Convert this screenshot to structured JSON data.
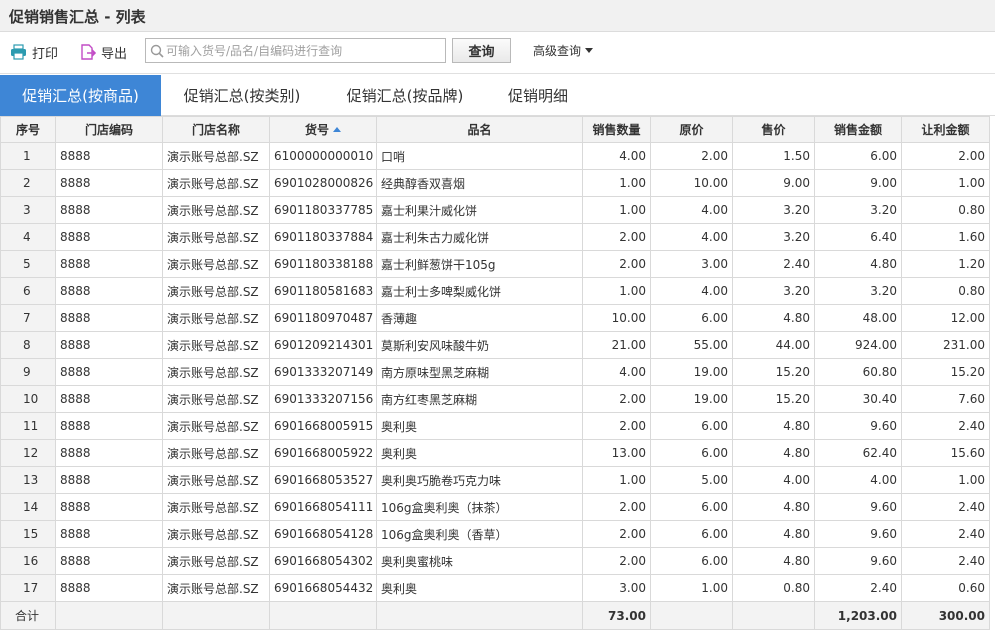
{
  "window": {
    "title": "促销销售汇总 - 列表"
  },
  "toolbar": {
    "print_label": "打印",
    "print_icon": "printer-icon",
    "export_label": "导出",
    "export_icon": "export-icon",
    "search_placeholder": "可输入货号/品名/自编码进行查询",
    "search_value": "",
    "query_label": "查询",
    "advanced_label": "高级查询"
  },
  "tabs": [
    {
      "label": "促销汇总(按商品)",
      "active": true
    },
    {
      "label": "促销汇总(按类别)",
      "active": false
    },
    {
      "label": "促销汇总(按品牌)",
      "active": false
    },
    {
      "label": "促销明细",
      "active": false
    }
  ],
  "table": {
    "columns": [
      "序号",
      "门店编码",
      "门店名称",
      "货号",
      "品名",
      "销售数量",
      "原价",
      "售价",
      "销售金额",
      "让利金额"
    ],
    "sort_column": "货号",
    "sort_direction": "asc",
    "rows": [
      [
        "1",
        "8888",
        "演示账号总部.SZ",
        "6100000000010",
        "口哨",
        "4.00",
        "2.00",
        "1.50",
        "6.00",
        "2.00"
      ],
      [
        "2",
        "8888",
        "演示账号总部.SZ",
        "6901028000826",
        "经典醇香双喜烟",
        "1.00",
        "10.00",
        "9.00",
        "9.00",
        "1.00"
      ],
      [
        "3",
        "8888",
        "演示账号总部.SZ",
        "6901180337785",
        "嘉士利果汁威化饼",
        "1.00",
        "4.00",
        "3.20",
        "3.20",
        "0.80"
      ],
      [
        "4",
        "8888",
        "演示账号总部.SZ",
        "6901180337884",
        "嘉士利朱古力威化饼",
        "2.00",
        "4.00",
        "3.20",
        "6.40",
        "1.60"
      ],
      [
        "5",
        "8888",
        "演示账号总部.SZ",
        "6901180338188",
        "嘉士利鲜葱饼干105g",
        "2.00",
        "3.00",
        "2.40",
        "4.80",
        "1.20"
      ],
      [
        "6",
        "8888",
        "演示账号总部.SZ",
        "6901180581683",
        "嘉士利士多啤梨威化饼",
        "1.00",
        "4.00",
        "3.20",
        "3.20",
        "0.80"
      ],
      [
        "7",
        "8888",
        "演示账号总部.SZ",
        "6901180970487",
        "香薄趣",
        "10.00",
        "6.00",
        "4.80",
        "48.00",
        "12.00"
      ],
      [
        "8",
        "8888",
        "演示账号总部.SZ",
        "6901209214301",
        "莫斯利安风味酸牛奶",
        "21.00",
        "55.00",
        "44.00",
        "924.00",
        "231.00"
      ],
      [
        "9",
        "8888",
        "演示账号总部.SZ",
        "6901333207149",
        "南方原味型黑芝麻糊",
        "4.00",
        "19.00",
        "15.20",
        "60.80",
        "15.20"
      ],
      [
        "10",
        "8888",
        "演示账号总部.SZ",
        "6901333207156",
        "南方红枣黑芝麻糊",
        "2.00",
        "19.00",
        "15.20",
        "30.40",
        "7.60"
      ],
      [
        "11",
        "8888",
        "演示账号总部.SZ",
        "6901668005915",
        "奥利奥",
        "2.00",
        "6.00",
        "4.80",
        "9.60",
        "2.40"
      ],
      [
        "12",
        "8888",
        "演示账号总部.SZ",
        "6901668005922",
        "奥利奥",
        "13.00",
        "6.00",
        "4.80",
        "62.40",
        "15.60"
      ],
      [
        "13",
        "8888",
        "演示账号总部.SZ",
        "6901668053527",
        "奥利奥巧脆卷巧克力味",
        "1.00",
        "5.00",
        "4.00",
        "4.00",
        "1.00"
      ],
      [
        "14",
        "8888",
        "演示账号总部.SZ",
        "6901668054111",
        "106g盒奥利奥（抹茶）",
        "2.00",
        "6.00",
        "4.80",
        "9.60",
        "2.40"
      ],
      [
        "15",
        "8888",
        "演示账号总部.SZ",
        "6901668054128",
        "106g盒奥利奥（香草）",
        "2.00",
        "6.00",
        "4.80",
        "9.60",
        "2.40"
      ],
      [
        "16",
        "8888",
        "演示账号总部.SZ",
        "6901668054302",
        "奥利奥蜜桃味",
        "2.00",
        "6.00",
        "4.80",
        "9.60",
        "2.40"
      ],
      [
        "17",
        "8888",
        "演示账号总部.SZ",
        "6901668054432",
        "奥利奥",
        "3.00",
        "1.00",
        "0.80",
        "2.40",
        "0.60"
      ]
    ],
    "total": {
      "label": "合计",
      "quantity": "73.00",
      "amount": "1,203.00",
      "discount": "300.00"
    }
  },
  "colors": {
    "accent": "#3e86d6",
    "header_bg": "#f3f3f3",
    "border": "#d9d9d9"
  }
}
